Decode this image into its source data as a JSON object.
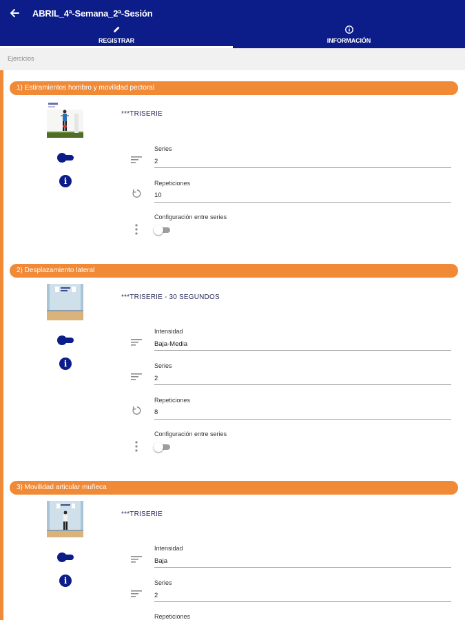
{
  "appbar": {
    "title": "ABRIL_4ª-Semana_2ª-Sesión",
    "back_icon": "arrow-left-icon",
    "background": "#0c1d8a"
  },
  "tabs": [
    {
      "label": "REGISTRAR",
      "icon": "pencil-icon",
      "active": true
    },
    {
      "label": "INFORMACIÓN",
      "icon": "info-circle-icon",
      "active": false
    }
  ],
  "section": {
    "label": "Ejercicios"
  },
  "accent_color": "#f08a36",
  "exercises": [
    {
      "title": "1) Estiramientos hombro y movilidad pectoral",
      "note": "***TRISERIE",
      "fields": [
        {
          "label": "Series",
          "value": "2"
        },
        {
          "label": "Repeticiones",
          "value": "10"
        }
      ],
      "config_label": "Configuración entre series"
    },
    {
      "title": "2) Desplazamiento lateral",
      "note": "***TRISERIE - 30 SEGUNDOS",
      "fields": [
        {
          "label": "Intensidad",
          "value": "Baja-Media"
        },
        {
          "label": "Series",
          "value": "2"
        },
        {
          "label": "Repeticiones",
          "value": "8"
        }
      ],
      "config_label": "Configuración entre series"
    },
    {
      "title": "3) Movilidad articular muñeca",
      "note": "***TRISERIE",
      "fields": [
        {
          "label": "Intensidad",
          "value": "Baja"
        },
        {
          "label": "Series",
          "value": "2"
        },
        {
          "label": "Repeticiones",
          "value": ""
        }
      ]
    }
  ]
}
